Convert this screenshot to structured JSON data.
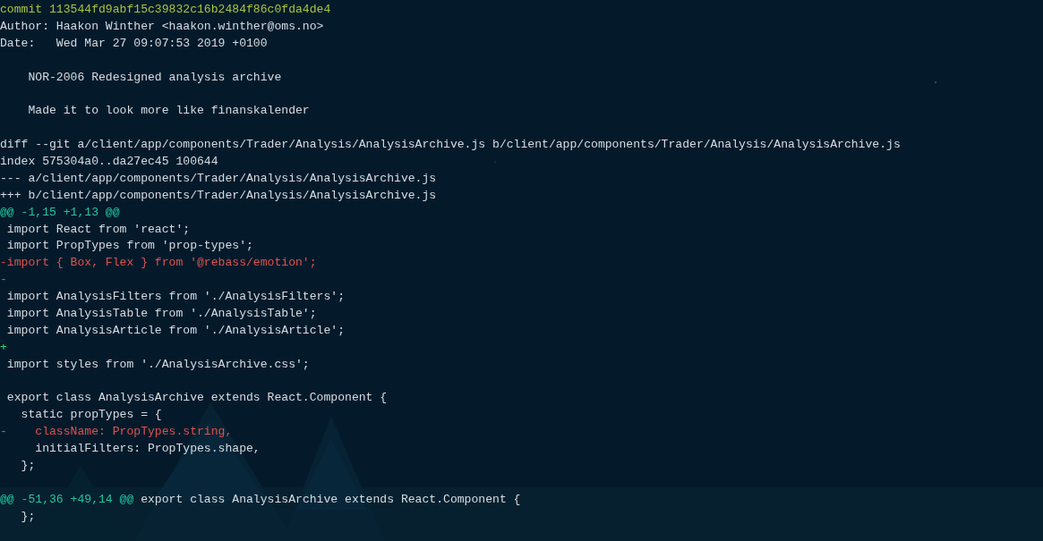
{
  "lines": [
    {
      "kind": "commit",
      "text": "commit 113544fd9abf15c39832c16b2484f86c0fda4de4"
    },
    {
      "kind": "meta",
      "text": "Author: Haakon Winther <haakon.winther@oms.no>"
    },
    {
      "kind": "meta",
      "text": "Date:   Wed Mar 27 09:07:53 2019 +0100"
    },
    {
      "kind": "blank"
    },
    {
      "kind": "meta",
      "text": "    NOR-2006 Redesigned analysis archive"
    },
    {
      "kind": "blank"
    },
    {
      "kind": "meta",
      "text": "    Made it to look more like finanskalender"
    },
    {
      "kind": "blank"
    },
    {
      "kind": "meta",
      "text": "diff --git a/client/app/components/Trader/Analysis/AnalysisArchive.js b/client/app/components/Trader/Analysis/AnalysisArchive.js"
    },
    {
      "kind": "meta",
      "text": "index 575304a0..da27ec45 100644"
    },
    {
      "kind": "meta",
      "text": "--- a/client/app/components/Trader/Analysis/AnalysisArchive.js"
    },
    {
      "kind": "meta",
      "text": "+++ b/client/app/components/Trader/Analysis/AnalysisArchive.js"
    },
    {
      "kind": "hunk",
      "text": "@@ -1,15 +1,13 @@"
    },
    {
      "kind": "context",
      "text": " import React from 'react';"
    },
    {
      "kind": "context",
      "text": " import PropTypes from 'prop-types';"
    },
    {
      "kind": "del",
      "text": "-import { Box, Flex } from '@rebass/emotion';"
    },
    {
      "kind": "del",
      "text": "-"
    },
    {
      "kind": "context",
      "text": " import AnalysisFilters from './AnalysisFilters';"
    },
    {
      "kind": "context",
      "text": " import AnalysisTable from './AnalysisTable';"
    },
    {
      "kind": "context",
      "text": " import AnalysisArticle from './AnalysisArticle';"
    },
    {
      "kind": "add",
      "text": "+"
    },
    {
      "kind": "context",
      "text": " import styles from './AnalysisArchive.css';"
    },
    {
      "kind": "blank"
    },
    {
      "kind": "context",
      "text": " export class AnalysisArchive extends React.Component {"
    },
    {
      "kind": "context",
      "text": "   static propTypes = {"
    },
    {
      "kind": "del",
      "text": "-    className: PropTypes.string,"
    },
    {
      "kind": "context",
      "text": "     initialFilters: PropTypes.shape,"
    },
    {
      "kind": "context",
      "text": "   };"
    },
    {
      "kind": "blank"
    },
    {
      "kind": "hunk",
      "text": "@@ -51,36 +49,14 @@",
      "context": " export class AnalysisArchive extends React.Component {"
    },
    {
      "kind": "context",
      "text": "   };"
    }
  ]
}
